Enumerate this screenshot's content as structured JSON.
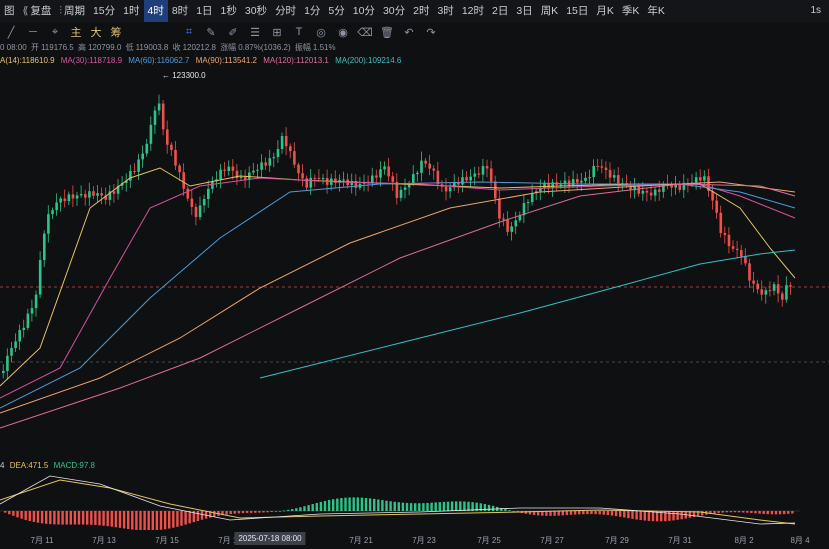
{
  "toolbar": {
    "items": [
      {
        "label": "图",
        "active": false
      },
      {
        "label": "复盘",
        "active": false
      },
      {
        "label": "周期",
        "active": false
      },
      {
        "label": "15分",
        "active": false
      },
      {
        "label": "1时",
        "active": false
      },
      {
        "label": "4时",
        "active": true
      },
      {
        "label": "8时",
        "active": false
      },
      {
        "label": "1日",
        "active": false
      },
      {
        "label": "1秒",
        "active": false
      },
      {
        "label": "30秒",
        "active": false
      },
      {
        "label": "分时",
        "active": false
      },
      {
        "label": "1分",
        "active": false
      },
      {
        "label": "5分",
        "active": false
      },
      {
        "label": "10分",
        "active": false
      },
      {
        "label": "30分",
        "active": false
      },
      {
        "label": "2时",
        "active": false
      },
      {
        "label": "3时",
        "active": false
      },
      {
        "label": "12时",
        "active": false
      },
      {
        "label": "2日",
        "active": false
      },
      {
        "label": "3日",
        "active": false
      },
      {
        "label": "周K",
        "active": false
      },
      {
        "label": "15日",
        "active": false
      },
      {
        "label": "月K",
        "active": false
      },
      {
        "label": "季K",
        "active": false
      },
      {
        "label": "年K",
        "active": false
      }
    ],
    "right_label": "1s"
  },
  "drawing_tools": {
    "icons": [
      "line-tool-icon",
      "horizontal-line-icon",
      "cursor-icon",
      "crosshair-tool-icon",
      "brush-icon",
      "pen-icon",
      "fibonacci-icon",
      "measure-icon",
      "text-tool-icon",
      "shape-tool-icon",
      "hide-icon",
      "eraser-icon",
      "delete-icon",
      "undo-icon",
      "redo-icon"
    ],
    "text_buttons": [
      "主",
      "大",
      "筹"
    ]
  },
  "ohlc": {
    "time": "0 08:00",
    "open_label": "开",
    "open": "119176.5",
    "high_label": "高",
    "high": "120799.0",
    "low_label": "低",
    "low": "119003.8",
    "close_label": "收",
    "close": "120212.8",
    "change_label": "涨幅",
    "change": "0.87%(1036.2)",
    "amplitude_label": "振幅",
    "amplitude": "1.51%"
  },
  "ma": [
    {
      "label": "A(14):118610.9",
      "color": "#e6c45a"
    },
    {
      "label": "MA(30):118718.9",
      "color": "#d94fa0"
    },
    {
      "label": "MA(60):116062.7",
      "color": "#4a9be0"
    },
    {
      "label": "MA(90):113541.2",
      "color": "#f0a36a"
    },
    {
      "label": "MA(120):112013.1",
      "color": "#e06a9a"
    },
    {
      "label": "MA(200):109214.6",
      "color": "#2bc4c4"
    }
  ],
  "macd": {
    "prefix": "4",
    "dea_label": "DEA:471.5",
    "macd_label": "MACD:97.8",
    "dea_color": "#e6c45a",
    "macd_color": "#2bc48a"
  },
  "chart_data": {
    "type": "candlestick",
    "high_annotation": "123300.0",
    "x_labels": [
      "7月 11",
      "7月 13",
      "7月 15",
      "7月 17",
      "7月 21",
      "7月 23",
      "7月 25",
      "7月 27",
      "7月 29",
      "7月 31",
      "8月 2",
      "8月 4"
    ],
    "crosshair_time": "2025-07-18 08:00",
    "up_color": "#2bc48a",
    "down_color": "#f0504a"
  }
}
